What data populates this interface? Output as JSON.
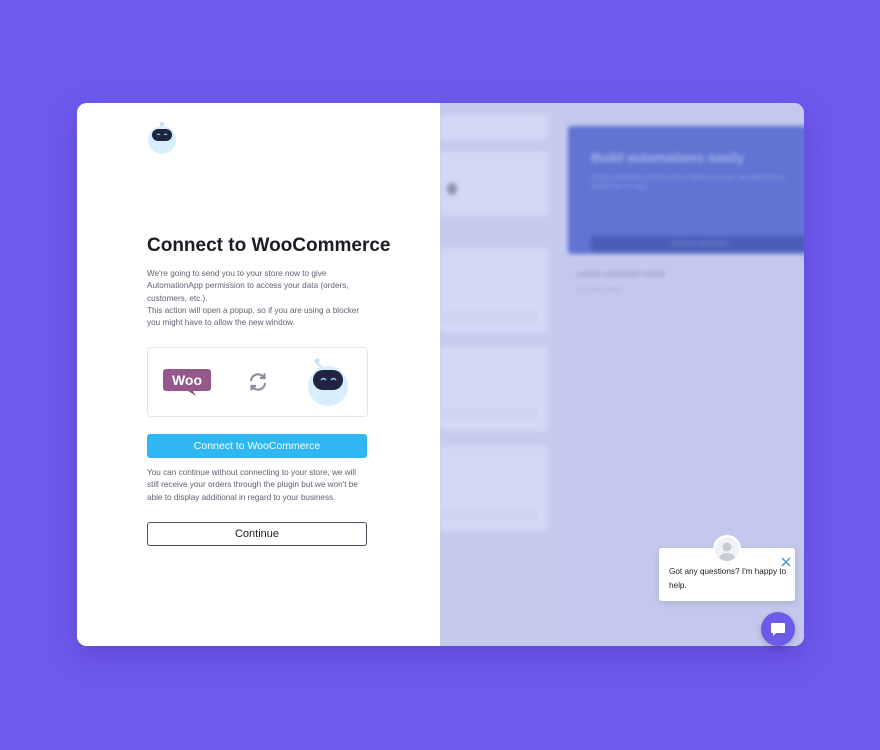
{
  "modal": {
    "title": "Connect to WooCommerce",
    "description_line1": "We're going to send you to your store now to give AutomationApp permission to access your data (orders, customers, etc.).",
    "description_line2": "This action will open a popup, so if you are using a blocker you might have to allow the new window.",
    "woo_logo_text": "Woo",
    "connect_button": "Connect to WooCommerce",
    "note": "You can continue without connecting to your store, we will still receive your orders through the plugin but we won't be able to display additional in regard to your business.",
    "continue_button": "Continue"
  },
  "background": {
    "promo_title": "Build automations easily",
    "promo_text": "Design automated ecommerce flows without any code. Get started with a custom flow. It's easy.",
    "promo_button": "Create an automation",
    "latest_title": "Latests automation events",
    "latest_empty": "No recent events"
  },
  "chat": {
    "message": "Got any questions? I'm happy to help."
  },
  "colors": {
    "page_bg": "#6f5af0",
    "primary_button": "#2eb7f2",
    "woo_purple": "#96588a",
    "chat_launcher": "#6a5ce8"
  },
  "icons": [
    "robot-logo-icon",
    "woocommerce-logo-icon",
    "sync-icon",
    "robot-mascot-icon",
    "close-icon",
    "chat-bubble-icon",
    "user-avatar-icon"
  ]
}
